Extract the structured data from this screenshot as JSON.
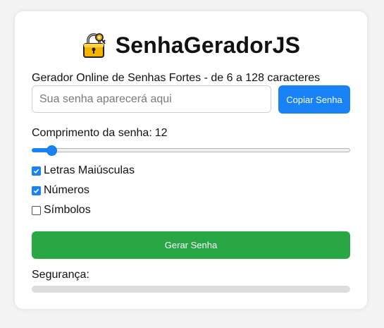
{
  "header": {
    "title": "SenhaGeradorJS",
    "icon": "lock-with-key-emoji"
  },
  "subtitle": "Gerador Online de Senhas Fortes - de 6 a 128 caracteres",
  "password": {
    "value": "",
    "placeholder": "Sua senha aparecerá aqui"
  },
  "copy_button": "Copiar Senha",
  "length": {
    "label": "Comprimento da senha:",
    "value": "12",
    "min": 6,
    "max": 128,
    "current": 12
  },
  "options": [
    {
      "label": "Letras Maiúsculas",
      "checked": true
    },
    {
      "label": "Números",
      "checked": true
    },
    {
      "label": "Símbolos",
      "checked": false
    }
  ],
  "generate_button": "Gerar Senha",
  "security": {
    "label": "Segurança:",
    "level": 0
  },
  "colors": {
    "primary": "#1a82f7",
    "success": "#29a745",
    "bar_bg": "#dddddd"
  }
}
